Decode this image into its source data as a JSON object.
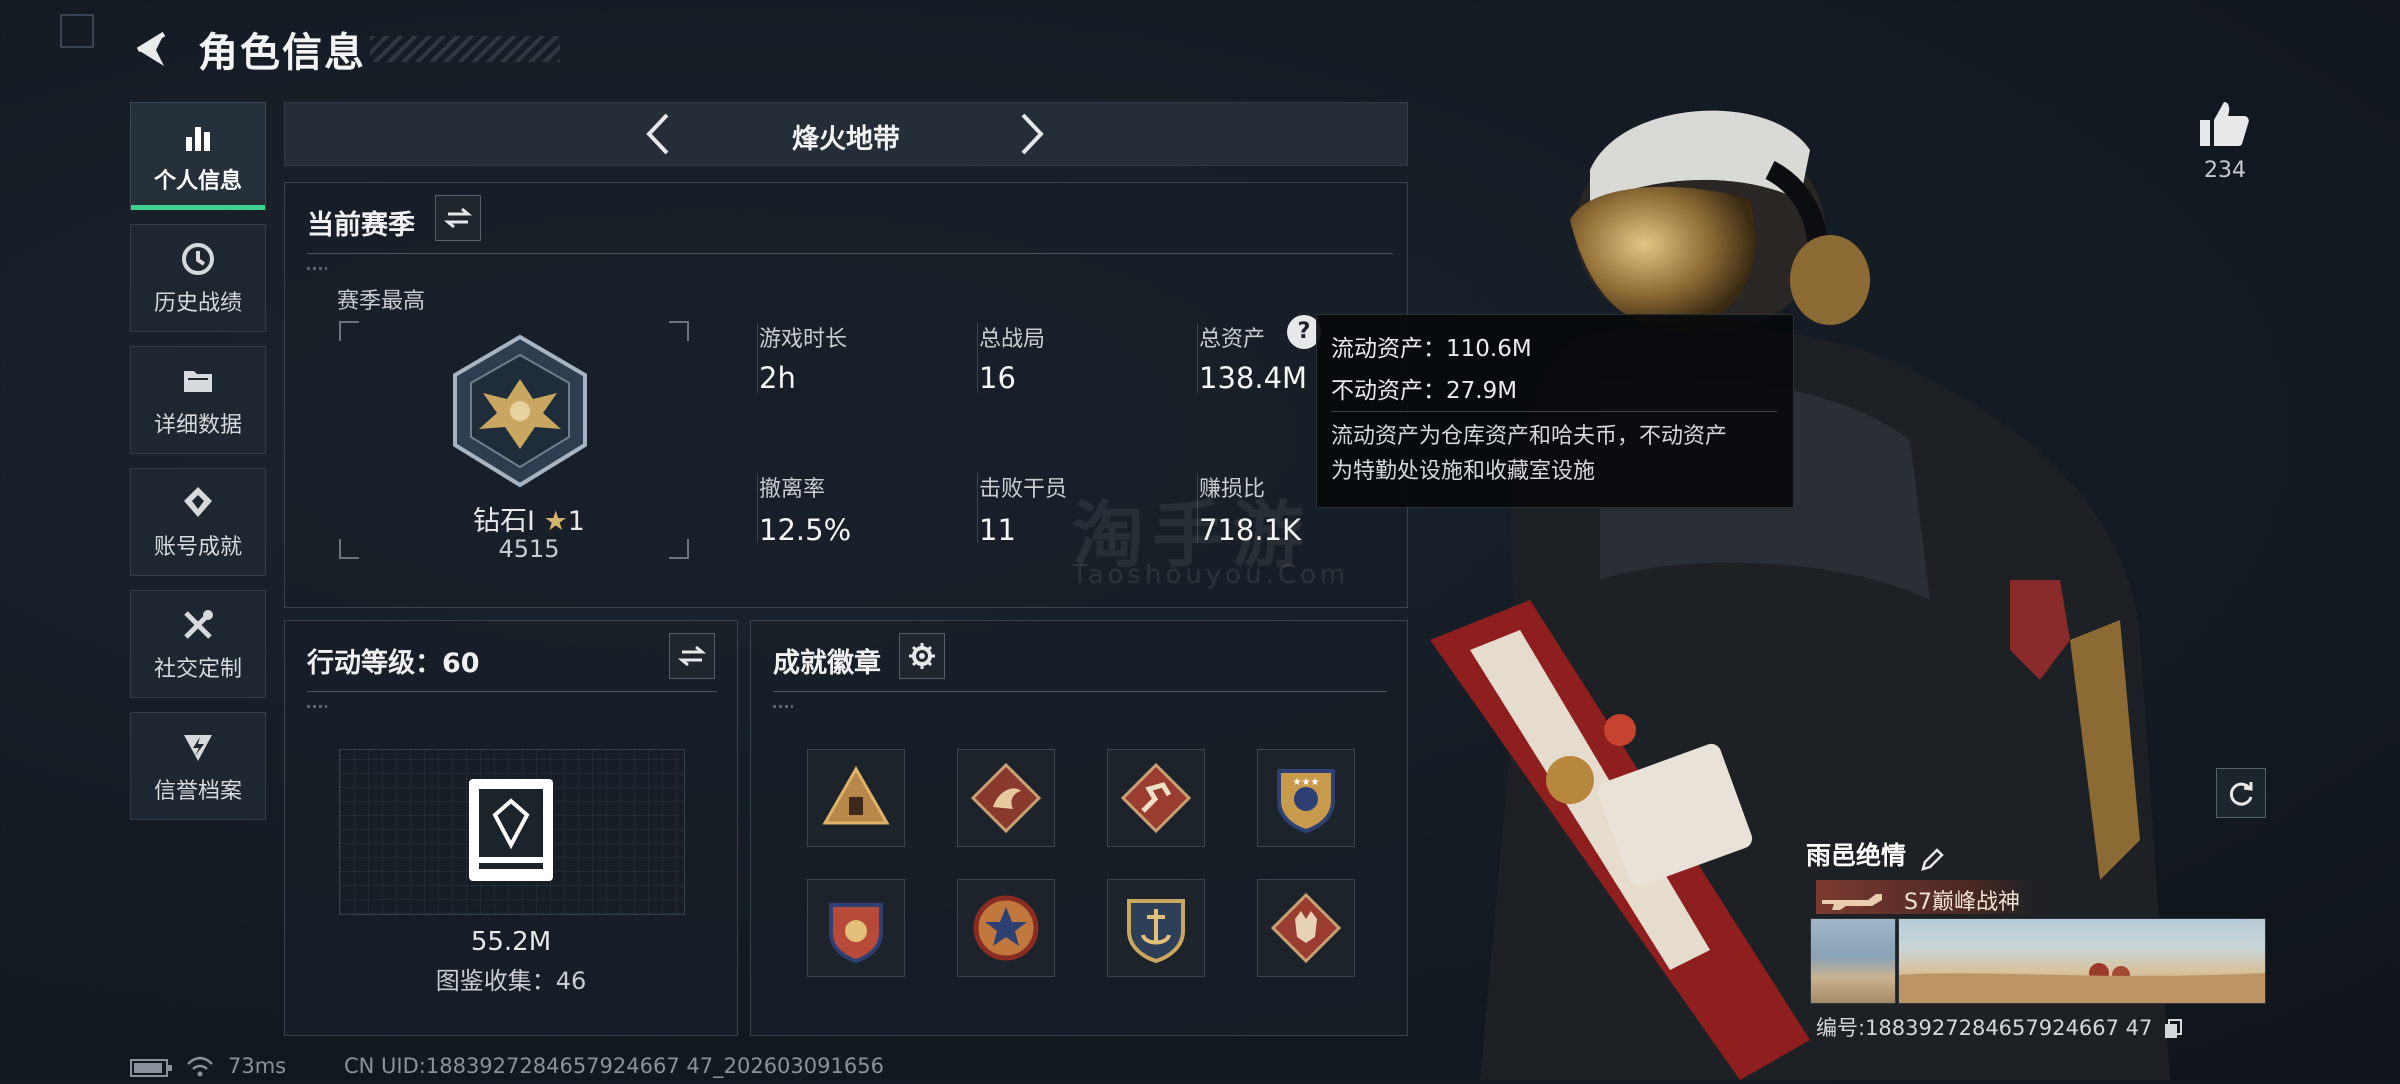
{
  "header": {
    "title": "角色信息"
  },
  "sidebar": {
    "items": [
      {
        "label": "个人信息",
        "icon": "bar-chart-icon",
        "active": true
      },
      {
        "label": "历史战绩",
        "icon": "history-icon"
      },
      {
        "label": "详细数据",
        "icon": "folder-icon"
      },
      {
        "label": "账号成就",
        "icon": "achievement-icon"
      },
      {
        "label": "社交定制",
        "icon": "tools-icon"
      },
      {
        "label": "信誉档案",
        "icon": "shield-bolt-icon"
      }
    ]
  },
  "mode": {
    "title": "烽火地带"
  },
  "season": {
    "title": "当前赛季",
    "best_label": "赛季最高",
    "rank_name": "钻石I",
    "rank_stars": "1",
    "rank_score": "4515",
    "stats": [
      {
        "label": "游戏时长",
        "value": "2h"
      },
      {
        "label": "总战局",
        "value": "16"
      },
      {
        "label": "总资产",
        "value": "138.4M"
      },
      {
        "label": "撤离率",
        "value": "12.5%"
      },
      {
        "label": "击败干员",
        "value": "11"
      },
      {
        "label": "赚损比",
        "value": "718.1K"
      }
    ]
  },
  "tooltip": {
    "liquid": "流动资产：110.6M",
    "fixed": "不动资产：27.9M",
    "note_line1": "流动资产为仓库资产和哈夫币，不动资产",
    "note_line2": "为特勤处设施和收藏室设施"
  },
  "level": {
    "title": "行动等级：60",
    "collection_value": "55.2M",
    "collection_label": "图鉴收集：46"
  },
  "badges": {
    "title": "成就徽章",
    "items": [
      "triangle-badge-icon",
      "dragon-badge-icon",
      "runner-badge-icon",
      "star-shield-badge-icon",
      "crest-badge-icon",
      "star-medal-badge-icon",
      "anchor-badge-icon",
      "wolf-badge-icon"
    ]
  },
  "character": {
    "likes": "234",
    "player_name": "雨邑绝情",
    "title_tag": "S7巅峰战神",
    "uid_line": "编号:1883927284657924667 47"
  },
  "footer": {
    "ping": "73ms",
    "uid": "CN UID:1883927284657924667 47_202603091656"
  },
  "watermark": {
    "main": "淘手游",
    "sub": "Taoshouyou.Com"
  }
}
